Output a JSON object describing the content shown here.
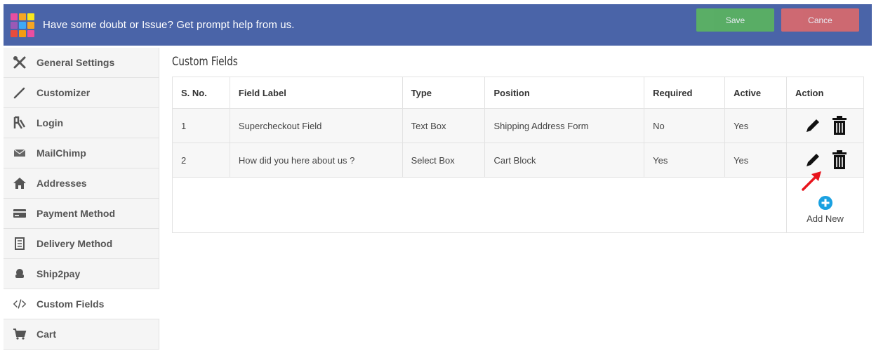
{
  "header": {
    "help_text": "Have some doubt or Issue? Get prompt help from us.",
    "save_label": "Save",
    "cancel_label": "Cance",
    "bg_color": "#4a64a8",
    "save_color": "#5cb85c",
    "cancel_color": "#e06a6a"
  },
  "sidebar": {
    "items": [
      {
        "label": "General Settings",
        "icon": "tools-icon",
        "active": false
      },
      {
        "label": "Customizer",
        "icon": "pencil-icon",
        "active": false
      },
      {
        "label": "Login",
        "icon": "users-icon",
        "active": false
      },
      {
        "label": "MailChimp",
        "icon": "envelope-icon",
        "active": false
      },
      {
        "label": "Addresses",
        "icon": "home-icon",
        "active": false
      },
      {
        "label": "Payment Method",
        "icon": "credit-card-icon",
        "active": false
      },
      {
        "label": "Delivery Method",
        "icon": "delivery-icon",
        "active": false
      },
      {
        "label": "Ship2pay",
        "icon": "ship-icon",
        "active": false
      },
      {
        "label": "Custom Fields",
        "icon": "code-icon",
        "active": true
      },
      {
        "label": "Cart",
        "icon": "cart-icon",
        "active": false
      }
    ]
  },
  "main": {
    "title": "Custom Fields",
    "table": {
      "headers": {
        "sno": "S. No.",
        "field_label": "Field Label",
        "type": "Type",
        "position": "Position",
        "required": "Required",
        "active": "Active",
        "action": "Action"
      },
      "rows": [
        {
          "sno": "1",
          "field_label": "Supercheckout Field",
          "type": "Text Box",
          "position": "Shipping Address Form",
          "required": "No",
          "active": "Yes"
        },
        {
          "sno": "2",
          "field_label": "How did you here about us ?",
          "type": "Select Box",
          "position": "Cart Block",
          "required": "Yes",
          "active": "Yes"
        }
      ],
      "add_new_label": "Add New"
    }
  }
}
